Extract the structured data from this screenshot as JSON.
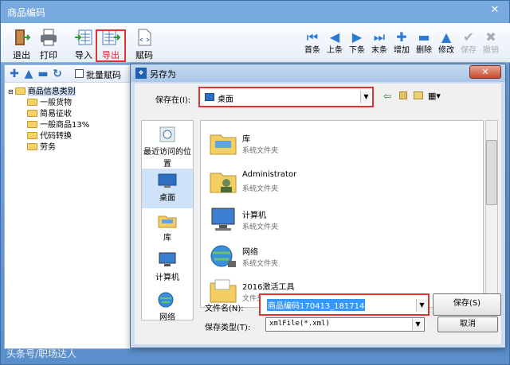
{
  "main_window": {
    "title": "商品编码",
    "close_symbol": "✕",
    "toolbar_left": [
      {
        "label": "退出",
        "icon": "exit-icon"
      },
      {
        "label": "打印",
        "icon": "printer-icon"
      },
      {
        "label": "导入",
        "icon": "import-icon"
      },
      {
        "label": "导出",
        "icon": "export-icon"
      },
      {
        "label": "赋码",
        "icon": "code-assign-icon"
      }
    ],
    "toolbar_right": [
      {
        "label": "首条",
        "glyph": "⏮",
        "disabled": false
      },
      {
        "label": "上条",
        "glyph": "◀",
        "disabled": false
      },
      {
        "label": "下条",
        "glyph": "▶",
        "disabled": false
      },
      {
        "label": "末条",
        "glyph": "⏭",
        "disabled": false
      },
      {
        "label": "增加",
        "glyph": "✚",
        "disabled": false
      },
      {
        "label": "删除",
        "glyph": "▬",
        "disabled": false
      },
      {
        "label": "修改",
        "glyph": "▲",
        "disabled": false
      },
      {
        "label": "保存",
        "glyph": "✔",
        "disabled": true
      },
      {
        "label": "撤销",
        "glyph": "✖",
        "disabled": true
      }
    ],
    "highlighted_tool": "导出"
  },
  "tree_panel": {
    "toolbar_glyphs": [
      "✚",
      "▲",
      "▬",
      "↻"
    ],
    "batch_label": "批量赋码",
    "batch_checked": false,
    "root": "商品信息类别",
    "children": [
      "一般货物",
      "简易征收",
      "一般商品13%",
      "代码转换",
      "劳务"
    ]
  },
  "save_dialog": {
    "title": "另存为",
    "close_symbol": "✕",
    "save_in_label": "保存在(I):",
    "save_in_value": "桌面",
    "places": [
      {
        "label": "最近访问的位置",
        "icon": "recent-icon",
        "selected": false
      },
      {
        "label": "桌面",
        "icon": "desktop-icon",
        "selected": true
      },
      {
        "label": "库",
        "icon": "library-icon",
        "selected": false
      },
      {
        "label": "计算机",
        "icon": "computer-icon",
        "selected": false
      },
      {
        "label": "网络",
        "icon": "network-icon",
        "selected": false
      }
    ],
    "files": [
      {
        "name": "库",
        "type": "系统文件夹",
        "icon": "library-icon"
      },
      {
        "name": "Administrator",
        "type": "系统文件夹",
        "icon": "user-icon"
      },
      {
        "name": "计算机",
        "type": "系统文件夹",
        "icon": "computer-icon"
      },
      {
        "name": "网络",
        "type": "系统文件夹",
        "icon": "network-icon"
      },
      {
        "name": "2016激活工具",
        "type": "文件夹",
        "icon": "folder-icon"
      }
    ],
    "filename_label": "文件名(N):",
    "filename_value": "商品编码170413_181714",
    "filetype_label": "保存类型(T):",
    "filetype_value": "xmlFile(*.xml)",
    "save_button": "保存(S)",
    "cancel_button": "取消"
  },
  "colors": {
    "accent": "#2d7ad6",
    "highlight": "#e23232",
    "selection": "#3399ff"
  },
  "watermark": "头条号/职场达人"
}
